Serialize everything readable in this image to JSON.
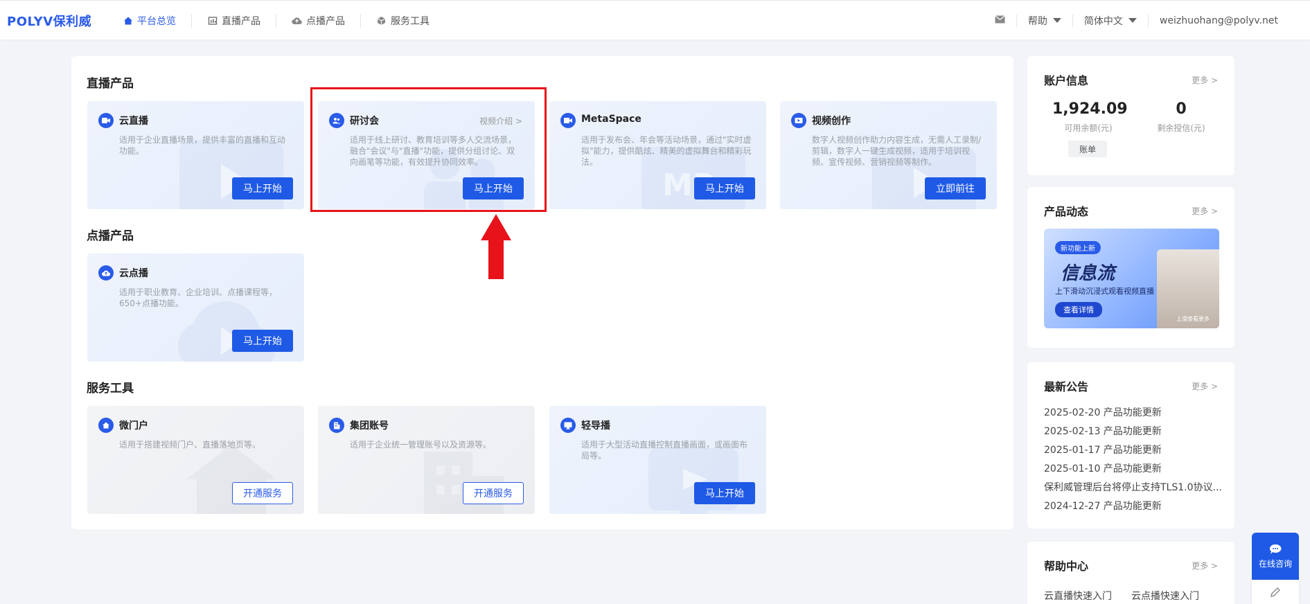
{
  "header": {
    "logo": "POLYV保利威",
    "nav": [
      {
        "label": "平台总览",
        "icon": "home-icon",
        "active": true
      },
      {
        "label": "直播产品",
        "icon": "chart-icon",
        "active": false
      },
      {
        "label": "点播产品",
        "icon": "cloud-icon",
        "active": false
      },
      {
        "label": "服务工具",
        "icon": "cube-icon",
        "active": false
      }
    ],
    "help": "帮助",
    "language": "简体中文",
    "user": "weizhuohang@polyv.net"
  },
  "sections": {
    "live": "直播产品",
    "vod": "点播产品",
    "tools": "服务工具"
  },
  "cards": {
    "cloud_live": {
      "title": "云直播",
      "desc": "适用于企业直播场景，提供丰富的直播和互动功能。",
      "button": "马上开始"
    },
    "seminar": {
      "title": "研讨会",
      "link": "视频介绍 >",
      "desc": "适用于线上研讨、教育培训等多人交流场景，融合\"会议\"与\"直播\"功能，提供分组讨论、双向画笔等功能，有效提升协同效率。",
      "button": "马上开始"
    },
    "metaspace": {
      "title": "MetaSpace",
      "desc": "适用于发布会、年会等活动场景，通过\"实时虚拟\"能力，提供酷炫、精美的虚拟舞台和精彩玩法。",
      "button": "马上开始"
    },
    "video_creation": {
      "title": "视频创作",
      "desc": "数字人视频创作助力内容生成，无需人工录制/剪辑，数字人一键生成视频，适用于培训视频、宣传视频、营销视频等制作。",
      "button": "立即前往"
    },
    "cloud_vod": {
      "title": "云点播",
      "desc": "适用于职业教育、企业培训、点播课程等，650+点播功能。",
      "button": "马上开始"
    },
    "micro_portal": {
      "title": "微门户",
      "desc": "适用于搭建视频门户、直播落地页等。",
      "button": "开通服务"
    },
    "group_account": {
      "title": "集团账号",
      "desc": "适用于企业统一管理账号以及资源等。",
      "button": "开通服务"
    },
    "light_director": {
      "title": "轻导播",
      "desc": "适用于大型活动直播控制直播画面，或画面布局等。",
      "button": "马上开始"
    }
  },
  "account": {
    "title": "账户信息",
    "more": "更多 >",
    "balance": "1,924.09",
    "balance_label": "可用余额(元)",
    "credit": "0",
    "credit_label": "剩余授信(元)",
    "bill": "账单"
  },
  "dynamics": {
    "title": "产品动态",
    "more": "更多 >",
    "banner_tag": "新功能上新",
    "banner_title": "信息流",
    "banner_sub": "上下滑动沉浸式观看视频直播",
    "banner_btn": "查看详情",
    "banner_phone_text": "上滑查看更多"
  },
  "notices": {
    "title": "最新公告",
    "more": "更多 >",
    "items": [
      "2025-02-20 产品功能更新",
      "2025-02-13 产品功能更新",
      "2025-01-17 产品功能更新",
      "2025-01-10 产品功能更新",
      "保利威管理后台将停止支持TLS1.0协议...",
      "2024-12-27 产品功能更新"
    ]
  },
  "help_center": {
    "title": "帮助中心",
    "more": "更多 >",
    "links": [
      "云直播快速入门",
      "云点播快速入门"
    ]
  },
  "float": {
    "consult": "在线咨询"
  },
  "colors": {
    "primary": "#1f5ae6",
    "highlight": "#e8121a"
  }
}
